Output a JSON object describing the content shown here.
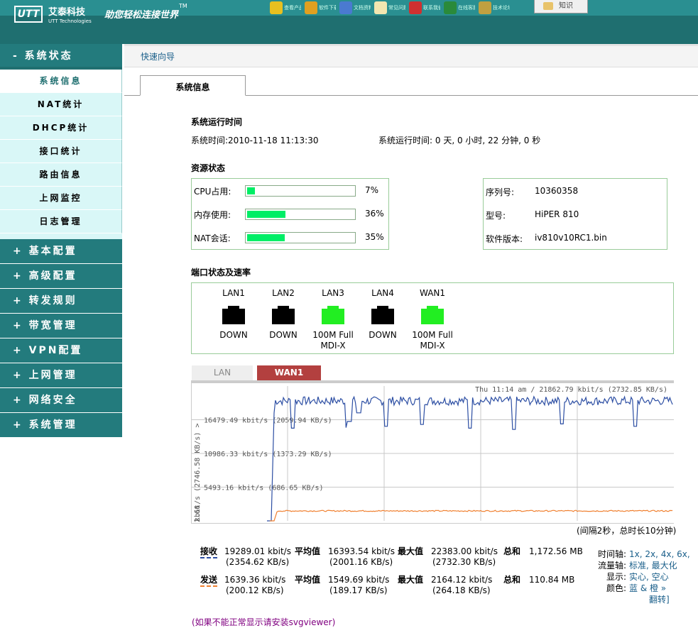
{
  "header": {
    "logo_mark": "UTT",
    "logo_cn": "艾泰科技",
    "logo_en": "UTT Technologies",
    "slogan": "助您轻松连接世界",
    "tm": "TM",
    "toolbar": [
      {
        "icon": "search-icon",
        "label": "查看产品",
        "color": "#e8c020"
      },
      {
        "icon": "download-icon",
        "label": "软件下载",
        "color": "#e0a020"
      },
      {
        "icon": "book-icon",
        "label": "文档资料",
        "color": "#4a7ad0"
      },
      {
        "icon": "note-icon",
        "label": "常见问题",
        "color": "#f2e6b0"
      },
      {
        "icon": "phone-icon",
        "label": "联系我们",
        "color": "#d03030"
      },
      {
        "icon": "user-icon",
        "label": "在线客服",
        "color": "#2a8a3a"
      },
      {
        "icon": "user-icon",
        "label": "技术论坛",
        "color": "#c0a040"
      }
    ],
    "knowledge": "知识"
  },
  "menu": {
    "system_status": "- 系统状态",
    "sub_items": [
      "系统信息",
      "NAT统计",
      "DHCP统计",
      "接口统计",
      "路由信息",
      "上网监控",
      "日志管理"
    ],
    "groups": [
      "+ 基本配置",
      "+ 高级配置",
      "+ 转发规则",
      "+ 带宽管理",
      "+ VPN配置",
      "+ 上网管理",
      "+ 网络安全",
      "+ 系统管理"
    ]
  },
  "breadcrumb": "快速向导",
  "tab": "系统信息",
  "runtime": {
    "title": "系统运行时间",
    "system_time_label": "系统时间:",
    "system_time": "2010-11-18 11:13:30",
    "uptime_label": "系统运行时间:",
    "uptime": "0 天, 0 小时, 22 分钟, 0 秒"
  },
  "resources": {
    "title": "资源状态",
    "items": [
      {
        "label": "CPU占用:",
        "value": "7%",
        "pct": 7
      },
      {
        "label": "内存使用:",
        "value": "36%",
        "pct": 36
      },
      {
        "label": "NAT会话:",
        "value": "35%",
        "pct": 35
      }
    ],
    "device": [
      {
        "label": "序列号:",
        "value": "10360358"
      },
      {
        "label": "型号:",
        "value": "HiPER 810"
      },
      {
        "label": "软件版本:",
        "value": "iv810v10RC1.bin"
      }
    ]
  },
  "ports": {
    "title": "端口状态及速率",
    "items": [
      {
        "name": "LAN1",
        "state1": "DOWN",
        "state2": "",
        "up": false
      },
      {
        "name": "LAN2",
        "state1": "DOWN",
        "state2": "",
        "up": false
      },
      {
        "name": "LAN3",
        "state1": "100M Full",
        "state2": "MDI-X",
        "up": true
      },
      {
        "name": "LAN4",
        "state1": "DOWN",
        "state2": "",
        "up": false
      },
      {
        "name": "WAN1",
        "state1": "100M Full",
        "state2": "MDI-X",
        "up": true
      }
    ],
    "colors": {
      "up": "#22ee22",
      "down": "#000000"
    }
  },
  "chart_tabs": {
    "lan": "LAN",
    "wan": "WAN1"
  },
  "chart_data": {
    "type": "line",
    "header_text": "Thu 11:14 am / 21862.79 kbit/s (2732.85 KB/s)",
    "y_axis_label": "kbit/s (2746.58 KB/s) >",
    "y_ticks": [
      {
        "value": 16479.49,
        "label": "16479.49 kbit/s (2059.94 KB/s)"
      },
      {
        "value": 10986.33,
        "label": "10986.33 kbit/s (1373.29 KB/s)"
      },
      {
        "value": 5493.16,
        "label": "5493.16 kbit/s (686.65 KB/s)"
      }
    ],
    "y_bottom_label": "2.66",
    "ylim": [
      0,
      21972.66
    ],
    "x_points": 300,
    "series": [
      {
        "color": "#2c4ea3",
        "start_index": 58,
        "level": 19550,
        "jitter": 700,
        "dips": [
          [
            143,
            15100
          ],
          [
            219,
            15200
          ],
          [
            222,
            16200
          ],
          [
            235,
            17600
          ],
          [
            273,
            15400
          ],
          [
            325,
            15700
          ],
          [
            392,
            15100
          ],
          [
            454,
            14900
          ],
          [
            522,
            15800
          ],
          [
            624,
            15400
          ]
        ]
      },
      {
        "color": "#f08030",
        "start_index": 60,
        "level": 1620,
        "jitter": 100,
        "dips": []
      }
    ],
    "note": "(间隔2秒，总时长10分钟)"
  },
  "stats": {
    "rx": {
      "label": "接收",
      "cur1": "19289.01 kbit/s",
      "cur2": "(2354.62 KB/s)",
      "avg_label": "平均值",
      "avg1": "16393.54 kbit/s",
      "avg2": "(2001.16 KB/s)",
      "max_label": "最大值",
      "max1": "22383.00 kbit/s",
      "max2": "(2732.30 KB/s)",
      "total_label": "总和",
      "total": "1,172.56 MB"
    },
    "tx": {
      "label": "发送",
      "cur1": "1639.36 kbit/s",
      "cur2": "(200.12 KB/s)",
      "avg_label": "平均值",
      "avg1": "1549.69 kbit/s",
      "avg2": "(189.17 KB/s)",
      "max_label": "最大值",
      "max1": "2164.12 kbit/s",
      "max2": "(264.18 KB/s)",
      "total_label": "总和",
      "total": "110.84 MB"
    },
    "options": {
      "timeaxis_label": "时间轴:",
      "timeaxis_values": "1x, 2x, 4x, 6x,",
      "flowaxis_label": "流量轴:",
      "flowaxis_values": "标准, 最大化",
      "display_label": "显示:",
      "display_values": "实心, 空心",
      "color_label": "颜色:",
      "color_values": "蓝 & 橙 »",
      "flip": "翻转]"
    }
  },
  "footnote": "(如果不能正常显示请安装svgviewer)"
}
